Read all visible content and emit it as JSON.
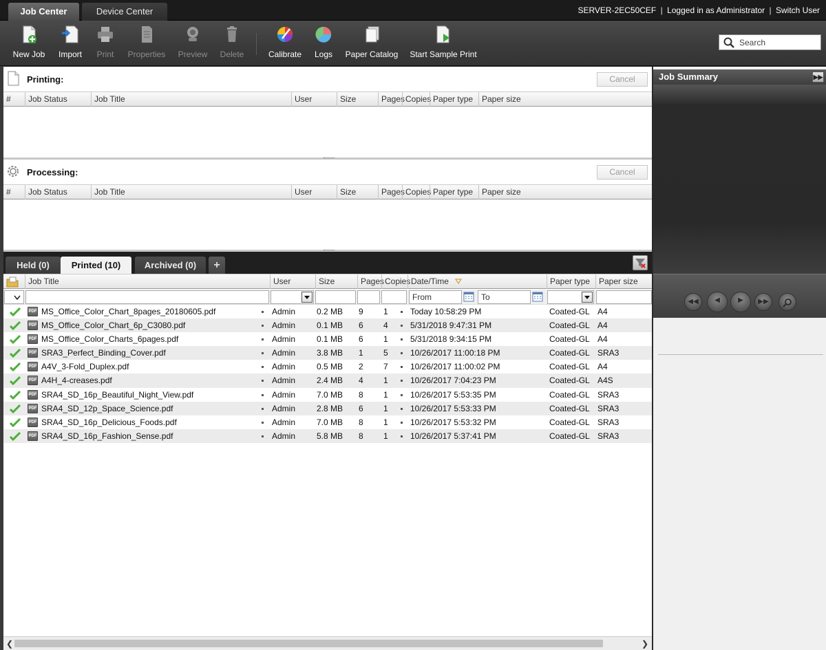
{
  "top_tabs": {
    "job_center": "Job Center",
    "device_center": "Device Center"
  },
  "server": {
    "name": "SERVER-2EC50CEF",
    "sep1": "|",
    "logged_in": "Logged in as Administrator",
    "sep2": "|",
    "switch_user": "Switch User"
  },
  "toolbar": {
    "new_job": "New Job",
    "import": "Import",
    "print": "Print",
    "properties": "Properties",
    "preview": "Preview",
    "delete": "Delete",
    "calibrate": "Calibrate",
    "logs": "Logs",
    "paper_catalog": "Paper Catalog",
    "start_sample_print": "Start Sample Print"
  },
  "search": {
    "placeholder": "Search"
  },
  "printing": {
    "title": "Printing:",
    "cancel": "Cancel"
  },
  "processing": {
    "title": "Processing:",
    "cancel": "Cancel"
  },
  "queue_columns": [
    "#",
    "Job Status",
    "Job Title",
    "User",
    "Size",
    "Pages",
    "Copies",
    "Paper type",
    "Paper size"
  ],
  "tabs": {
    "held": "Held (0)",
    "printed": "Printed (10)",
    "archived": "Archived (0)",
    "add": "+"
  },
  "printed_columns": {
    "job_title": "Job Title",
    "user": "User",
    "size": "Size",
    "pages": "Pages",
    "copies": "Copies",
    "datetime": "Date/Time",
    "paper_type": "Paper type",
    "paper_size": "Paper size"
  },
  "filters": {
    "from": "From",
    "to": "To"
  },
  "jobs": [
    {
      "title": "MS_Office_Color_Chart_8pages_20180605.pdf",
      "user": "Admin",
      "size": "0.2 MB",
      "pages": "9",
      "copies": "1",
      "datetime": "Today 10:58:29 PM",
      "paper_type": "Coated-GL",
      "paper_size": "A4"
    },
    {
      "title": "MS_Office_Color_Chart_6p_C3080.pdf",
      "user": "Admin",
      "size": "0.1 MB",
      "pages": "6",
      "copies": "4",
      "datetime": "5/31/2018 9:47:31 PM",
      "paper_type": "Coated-GL",
      "paper_size": "A4"
    },
    {
      "title": "MS_Office_Color_Charts_6pages.pdf",
      "user": "Admin",
      "size": "0.1 MB",
      "pages": "6",
      "copies": "1",
      "datetime": "5/31/2018 9:34:15 PM",
      "paper_type": "Coated-GL",
      "paper_size": "A4"
    },
    {
      "title": "SRA3_Perfect_Binding_Cover.pdf",
      "user": "Admin",
      "size": "3.8 MB",
      "pages": "1",
      "copies": "5",
      "datetime": "10/26/2017 11:00:18 PM",
      "paper_type": "Coated-GL",
      "paper_size": "SRA3"
    },
    {
      "title": "A4V_3-Fold_Duplex.pdf",
      "user": "Admin",
      "size": "0.5 MB",
      "pages": "2",
      "copies": "7",
      "datetime": "10/26/2017 11:00:02 PM",
      "paper_type": "Coated-GL",
      "paper_size": "A4"
    },
    {
      "title": "A4H_4-creases.pdf",
      "user": "Admin",
      "size": "2.4 MB",
      "pages": "4",
      "copies": "1",
      "datetime": "10/26/2017 7:04:23 PM",
      "paper_type": "Coated-GL",
      "paper_size": "A4S"
    },
    {
      "title": "SRA4_SD_16p_Beautiful_Night_View.pdf",
      "user": "Admin",
      "size": "7.0 MB",
      "pages": "8",
      "copies": "1",
      "datetime": "10/26/2017 5:53:35 PM",
      "paper_type": "Coated-GL",
      "paper_size": "SRA3"
    },
    {
      "title": "SRA4_SD_12p_Space_Science.pdf",
      "user": "Admin",
      "size": "2.8 MB",
      "pages": "6",
      "copies": "1",
      "datetime": "10/26/2017 5:53:33 PM",
      "paper_type": "Coated-GL",
      "paper_size": "SRA3"
    },
    {
      "title": "SRA4_SD_16p_Delicious_Foods.pdf",
      "user": "Admin",
      "size": "7.0 MB",
      "pages": "8",
      "copies": "1",
      "datetime": "10/26/2017 5:53:32 PM",
      "paper_type": "Coated-GL",
      "paper_size": "SRA3"
    },
    {
      "title": "SRA4_SD_16p_Fashion_Sense.pdf",
      "user": "Admin",
      "size": "5.8 MB",
      "pages": "8",
      "copies": "1",
      "datetime": "10/26/2017 5:37:41 PM",
      "paper_type": "Coated-GL",
      "paper_size": "SRA3"
    }
  ],
  "pdf_badge": "PDF",
  "job_summary": {
    "title": "Job Summary"
  },
  "icons": {
    "new_job": "new-document-icon",
    "import": "import-icon",
    "print": "printer-icon",
    "properties": "properties-icon",
    "preview": "preview-icon",
    "delete": "trash-icon",
    "calibrate": "color-wheel-icon",
    "logs": "pie-chart-icon",
    "paper_catalog": "paper-stack-icon",
    "sample_print": "sample-print-icon",
    "search": "search-icon",
    "status": "checkmark-icon",
    "file": "pdf-icon"
  },
  "colors": {
    "check_green": "#4caf3b",
    "header_dark": "#1b1b1b",
    "toolbar": "#3f3f3f"
  }
}
